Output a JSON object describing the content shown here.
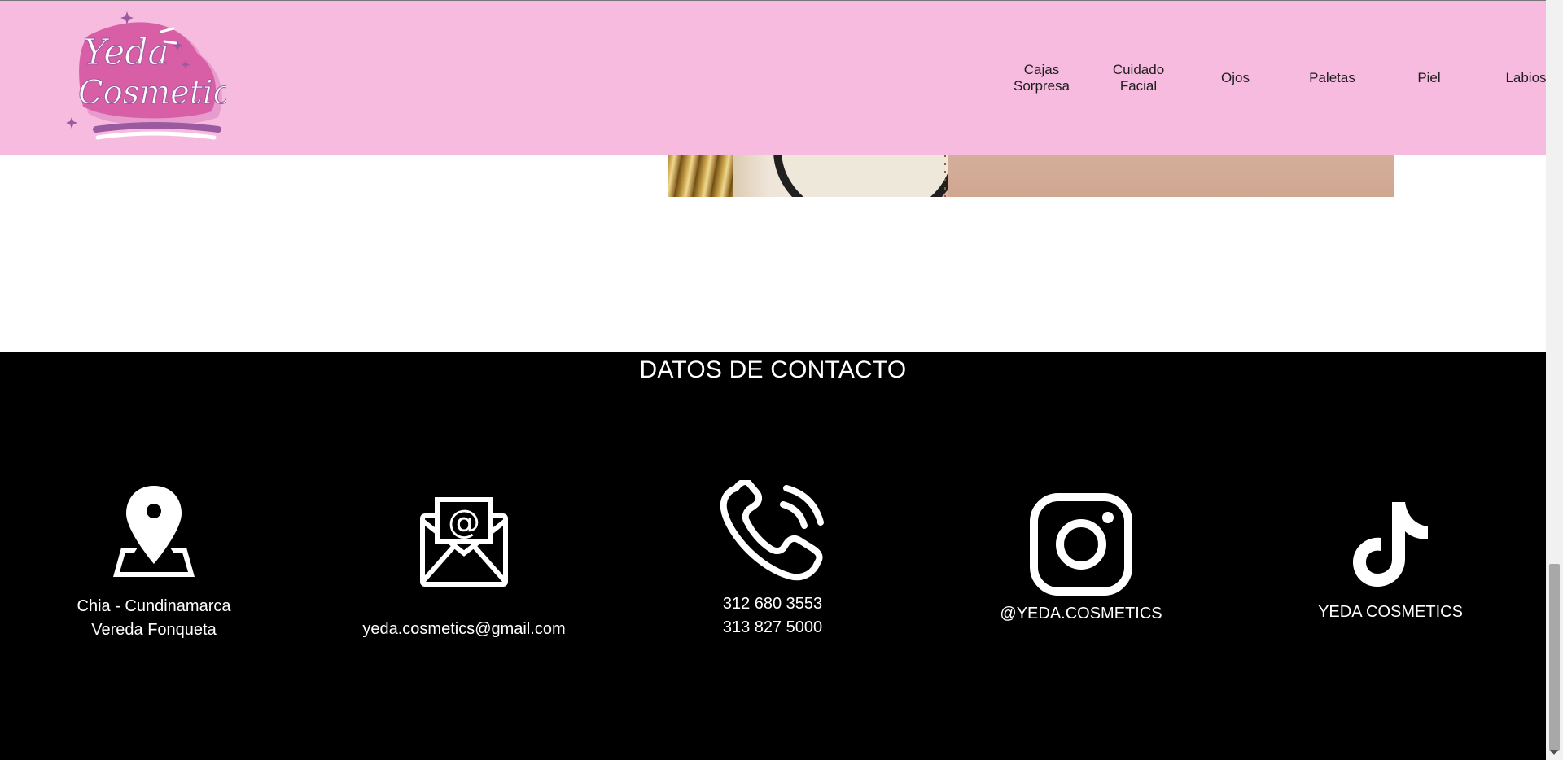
{
  "header": {
    "logo": {
      "text_line1": "Yeda",
      "text_line2": "Cosmetics"
    },
    "nav": [
      {
        "label": "Cajas\nSorpresa"
      },
      {
        "label": "Cuidado\nFacial"
      },
      {
        "label": "Ojos"
      },
      {
        "label": "Paletas"
      },
      {
        "label": "Piel"
      },
      {
        "label": "Labios"
      }
    ]
  },
  "contact": {
    "title": "DATOS DE CONTACTO",
    "location": {
      "icon": "map-pin-icon",
      "line1": "Chia - Cundinamarca",
      "line2": "Vereda Fonqueta"
    },
    "email": {
      "icon": "mail-envelope-icon",
      "text": "yeda.cosmetics@gmail.com"
    },
    "phone": {
      "icon": "phone-icon",
      "line1": "312 680 3553",
      "line2": "313 827 5000"
    },
    "instagram": {
      "icon": "instagram-icon",
      "text": "@YEDA.COSMETICS"
    },
    "tiktok": {
      "icon": "tiktok-icon",
      "text": "YEDA COSMETICS"
    }
  },
  "colors": {
    "header_bg": "#f7bbdf",
    "footer_bg": "#000000",
    "footer_text": "#ffffff",
    "logo_pink": "#d85fa6",
    "logo_purple": "#9b5aa0"
  }
}
